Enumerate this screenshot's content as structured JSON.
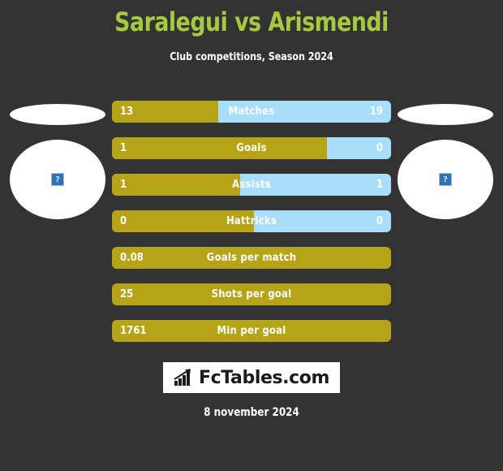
{
  "header": {
    "title": "Saralegui vs Arismendi",
    "subtitle": "Club competitions, Season 2024",
    "title_color": "#a5c940"
  },
  "players": {
    "home": {
      "name": "",
      "photo_icon": "broken-image-icon",
      "photo_alt": "?"
    },
    "away": {
      "name": "",
      "photo_icon": "broken-image-icon",
      "photo_alt": "?"
    }
  },
  "colors": {
    "background": "#333333",
    "home_bar": "#b7a317",
    "away_bar": "#a9defb",
    "text": "#ffffff"
  },
  "chart_data": {
    "type": "bar",
    "title": "Saralegui vs Arismendi",
    "subtitle": "Club competitions, Season 2024",
    "orientation": "horizontal-diverging",
    "series": [
      {
        "name": "Saralegui",
        "color": "#b7a317",
        "values": [
          13,
          1,
          1,
          0,
          0.08,
          25,
          1761
        ]
      },
      {
        "name": "Arismendi",
        "color": "#a9defb",
        "values": [
          19,
          0,
          1,
          0,
          null,
          null,
          null
        ]
      }
    ],
    "categories": [
      "Matches",
      "Goals",
      "Assists",
      "Hattricks",
      "Goals per match",
      "Shots per goal",
      "Min per goal"
    ]
  },
  "stats": [
    {
      "label": "Matches",
      "home": "13",
      "away": "19",
      "home_pct": 38,
      "split": true
    },
    {
      "label": "Goals",
      "home": "1",
      "away": "0",
      "home_pct": 77,
      "split": true
    },
    {
      "label": "Assists",
      "home": "1",
      "away": "1",
      "home_pct": 46,
      "split": true
    },
    {
      "label": "Hattricks",
      "home": "0",
      "away": "0",
      "home_pct": 51,
      "split": true
    },
    {
      "label": "Goals per match",
      "home": "0.08",
      "away": "",
      "home_pct": 100,
      "split": false
    },
    {
      "label": "Shots per goal",
      "home": "25",
      "away": "",
      "home_pct": 100,
      "split": false
    },
    {
      "label": "Min per goal",
      "home": "1761",
      "away": "",
      "home_pct": 100,
      "split": false
    }
  ],
  "logo": {
    "text": "FcTables.com",
    "icon": "bar-chart-growth-icon"
  },
  "footer": {
    "date": "8 november 2024"
  }
}
